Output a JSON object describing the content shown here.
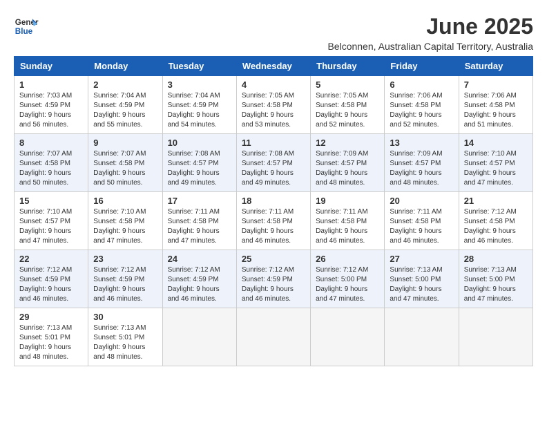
{
  "logo": {
    "line1": "General",
    "line2": "Blue"
  },
  "title": "June 2025",
  "location": "Belconnen, Australian Capital Territory, Australia",
  "weekdays": [
    "Sunday",
    "Monday",
    "Tuesday",
    "Wednesday",
    "Thursday",
    "Friday",
    "Saturday"
  ],
  "weeks": [
    [
      {
        "day": "1",
        "sunrise": "7:03 AM",
        "sunset": "4:59 PM",
        "daylight": "9 hours and 56 minutes."
      },
      {
        "day": "2",
        "sunrise": "7:04 AM",
        "sunset": "4:59 PM",
        "daylight": "9 hours and 55 minutes."
      },
      {
        "day": "3",
        "sunrise": "7:04 AM",
        "sunset": "4:59 PM",
        "daylight": "9 hours and 54 minutes."
      },
      {
        "day": "4",
        "sunrise": "7:05 AM",
        "sunset": "4:58 PM",
        "daylight": "9 hours and 53 minutes."
      },
      {
        "day": "5",
        "sunrise": "7:05 AM",
        "sunset": "4:58 PM",
        "daylight": "9 hours and 52 minutes."
      },
      {
        "day": "6",
        "sunrise": "7:06 AM",
        "sunset": "4:58 PM",
        "daylight": "9 hours and 52 minutes."
      },
      {
        "day": "7",
        "sunrise": "7:06 AM",
        "sunset": "4:58 PM",
        "daylight": "9 hours and 51 minutes."
      }
    ],
    [
      {
        "day": "8",
        "sunrise": "7:07 AM",
        "sunset": "4:58 PM",
        "daylight": "9 hours and 50 minutes."
      },
      {
        "day": "9",
        "sunrise": "7:07 AM",
        "sunset": "4:58 PM",
        "daylight": "9 hours and 50 minutes."
      },
      {
        "day": "10",
        "sunrise": "7:08 AM",
        "sunset": "4:57 PM",
        "daylight": "9 hours and 49 minutes."
      },
      {
        "day": "11",
        "sunrise": "7:08 AM",
        "sunset": "4:57 PM",
        "daylight": "9 hours and 49 minutes."
      },
      {
        "day": "12",
        "sunrise": "7:09 AM",
        "sunset": "4:57 PM",
        "daylight": "9 hours and 48 minutes."
      },
      {
        "day": "13",
        "sunrise": "7:09 AM",
        "sunset": "4:57 PM",
        "daylight": "9 hours and 48 minutes."
      },
      {
        "day": "14",
        "sunrise": "7:10 AM",
        "sunset": "4:57 PM",
        "daylight": "9 hours and 47 minutes."
      }
    ],
    [
      {
        "day": "15",
        "sunrise": "7:10 AM",
        "sunset": "4:57 PM",
        "daylight": "9 hours and 47 minutes."
      },
      {
        "day": "16",
        "sunrise": "7:10 AM",
        "sunset": "4:58 PM",
        "daylight": "9 hours and 47 minutes."
      },
      {
        "day": "17",
        "sunrise": "7:11 AM",
        "sunset": "4:58 PM",
        "daylight": "9 hours and 47 minutes."
      },
      {
        "day": "18",
        "sunrise": "7:11 AM",
        "sunset": "4:58 PM",
        "daylight": "9 hours and 46 minutes."
      },
      {
        "day": "19",
        "sunrise": "7:11 AM",
        "sunset": "4:58 PM",
        "daylight": "9 hours and 46 minutes."
      },
      {
        "day": "20",
        "sunrise": "7:11 AM",
        "sunset": "4:58 PM",
        "daylight": "9 hours and 46 minutes."
      },
      {
        "day": "21",
        "sunrise": "7:12 AM",
        "sunset": "4:58 PM",
        "daylight": "9 hours and 46 minutes."
      }
    ],
    [
      {
        "day": "22",
        "sunrise": "7:12 AM",
        "sunset": "4:59 PM",
        "daylight": "9 hours and 46 minutes."
      },
      {
        "day": "23",
        "sunrise": "7:12 AM",
        "sunset": "4:59 PM",
        "daylight": "9 hours and 46 minutes."
      },
      {
        "day": "24",
        "sunrise": "7:12 AM",
        "sunset": "4:59 PM",
        "daylight": "9 hours and 46 minutes."
      },
      {
        "day": "25",
        "sunrise": "7:12 AM",
        "sunset": "4:59 PM",
        "daylight": "9 hours and 46 minutes."
      },
      {
        "day": "26",
        "sunrise": "7:12 AM",
        "sunset": "5:00 PM",
        "daylight": "9 hours and 47 minutes."
      },
      {
        "day": "27",
        "sunrise": "7:13 AM",
        "sunset": "5:00 PM",
        "daylight": "9 hours and 47 minutes."
      },
      {
        "day": "28",
        "sunrise": "7:13 AM",
        "sunset": "5:00 PM",
        "daylight": "9 hours and 47 minutes."
      }
    ],
    [
      {
        "day": "29",
        "sunrise": "7:13 AM",
        "sunset": "5:01 PM",
        "daylight": "9 hours and 48 minutes."
      },
      {
        "day": "30",
        "sunrise": "7:13 AM",
        "sunset": "5:01 PM",
        "daylight": "9 hours and 48 minutes."
      },
      null,
      null,
      null,
      null,
      null
    ]
  ],
  "labels": {
    "sunrise": "Sunrise:",
    "sunset": "Sunset:",
    "daylight": "Daylight:"
  }
}
